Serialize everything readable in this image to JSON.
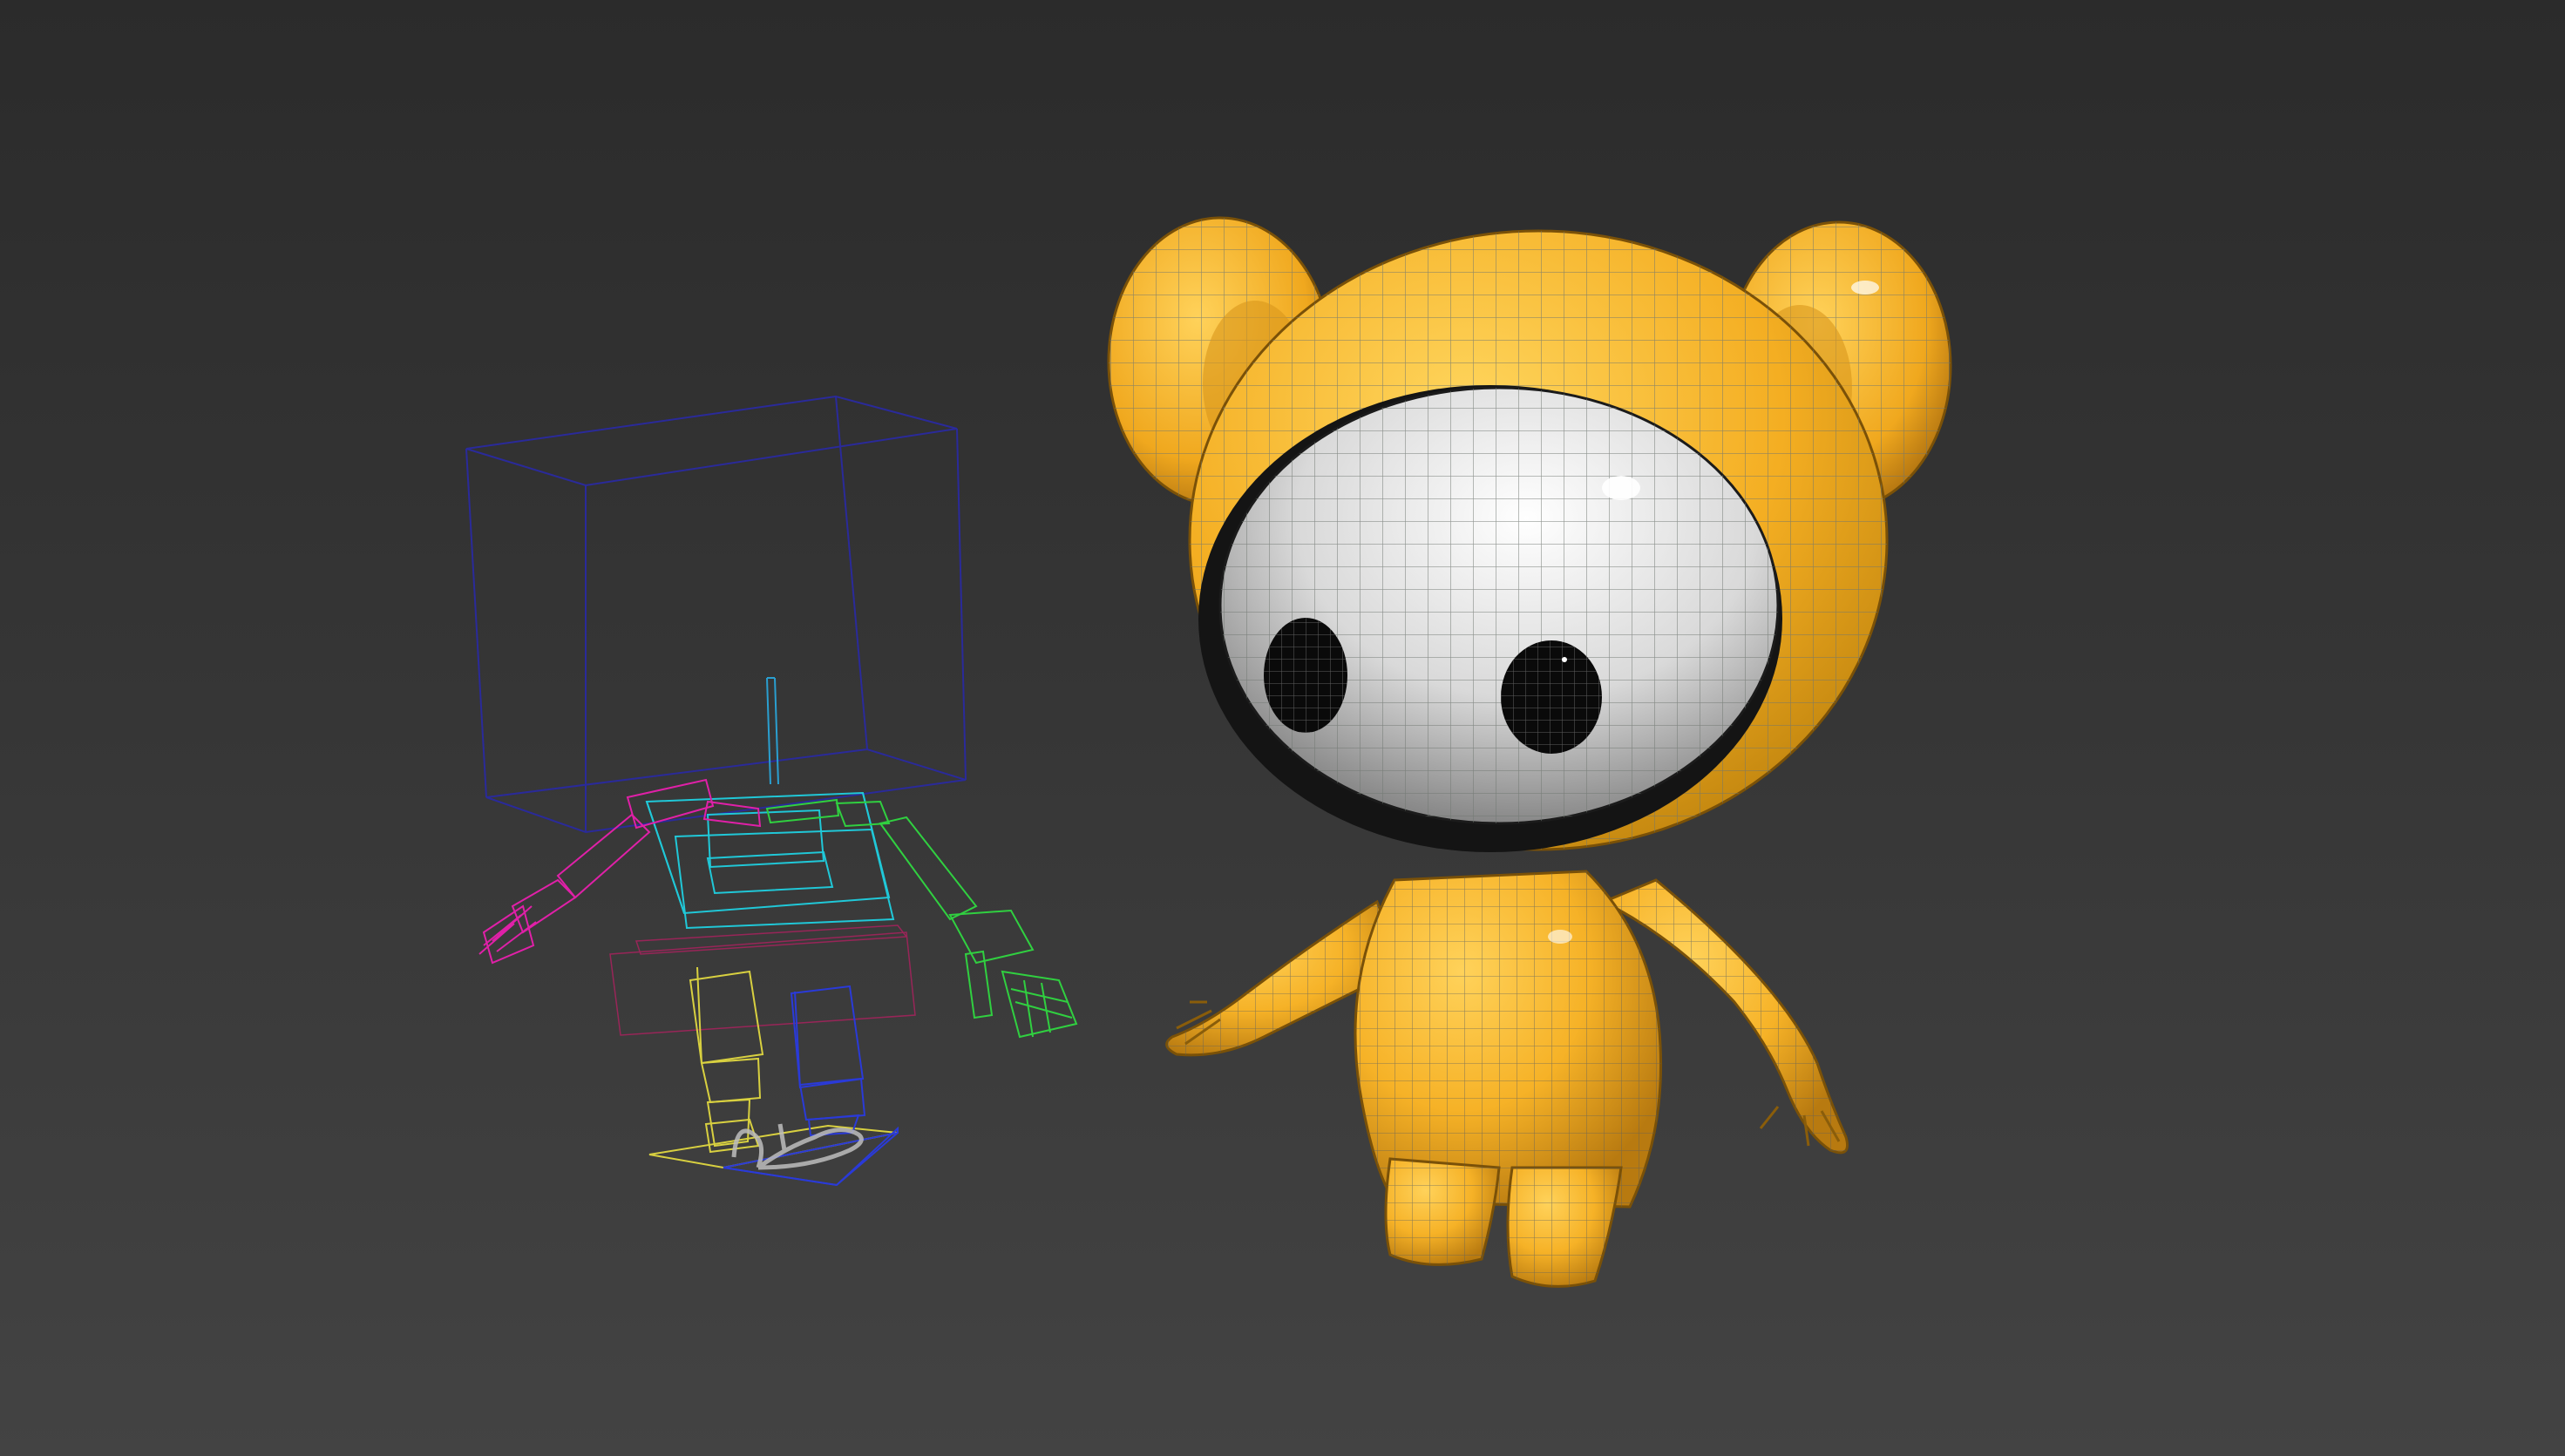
{
  "viewport": {
    "background_top": "#2b2b2b",
    "background_bottom": "#434343"
  },
  "rig": {
    "head_box_color": "#2a2a9a",
    "pelvis_color": "#20c8d8",
    "spine_color": "#2a9fd0",
    "right_arm_color": "#e020a8",
    "left_arm_color": "#30d040",
    "left_leg_color": "#d8d040",
    "right_leg_color": "#2a3ad8",
    "hip_color": "#b02060",
    "footstep_color": "#bdbdbd"
  },
  "character": {
    "body_color": "#f6b227",
    "face_color": "#e8e8e8",
    "eye_color": "#0a0a0a",
    "wire_color": "#6e7570"
  },
  "icons": {
    "rig": "biped-skeleton-icon",
    "mesh": "bear-character-mesh"
  }
}
